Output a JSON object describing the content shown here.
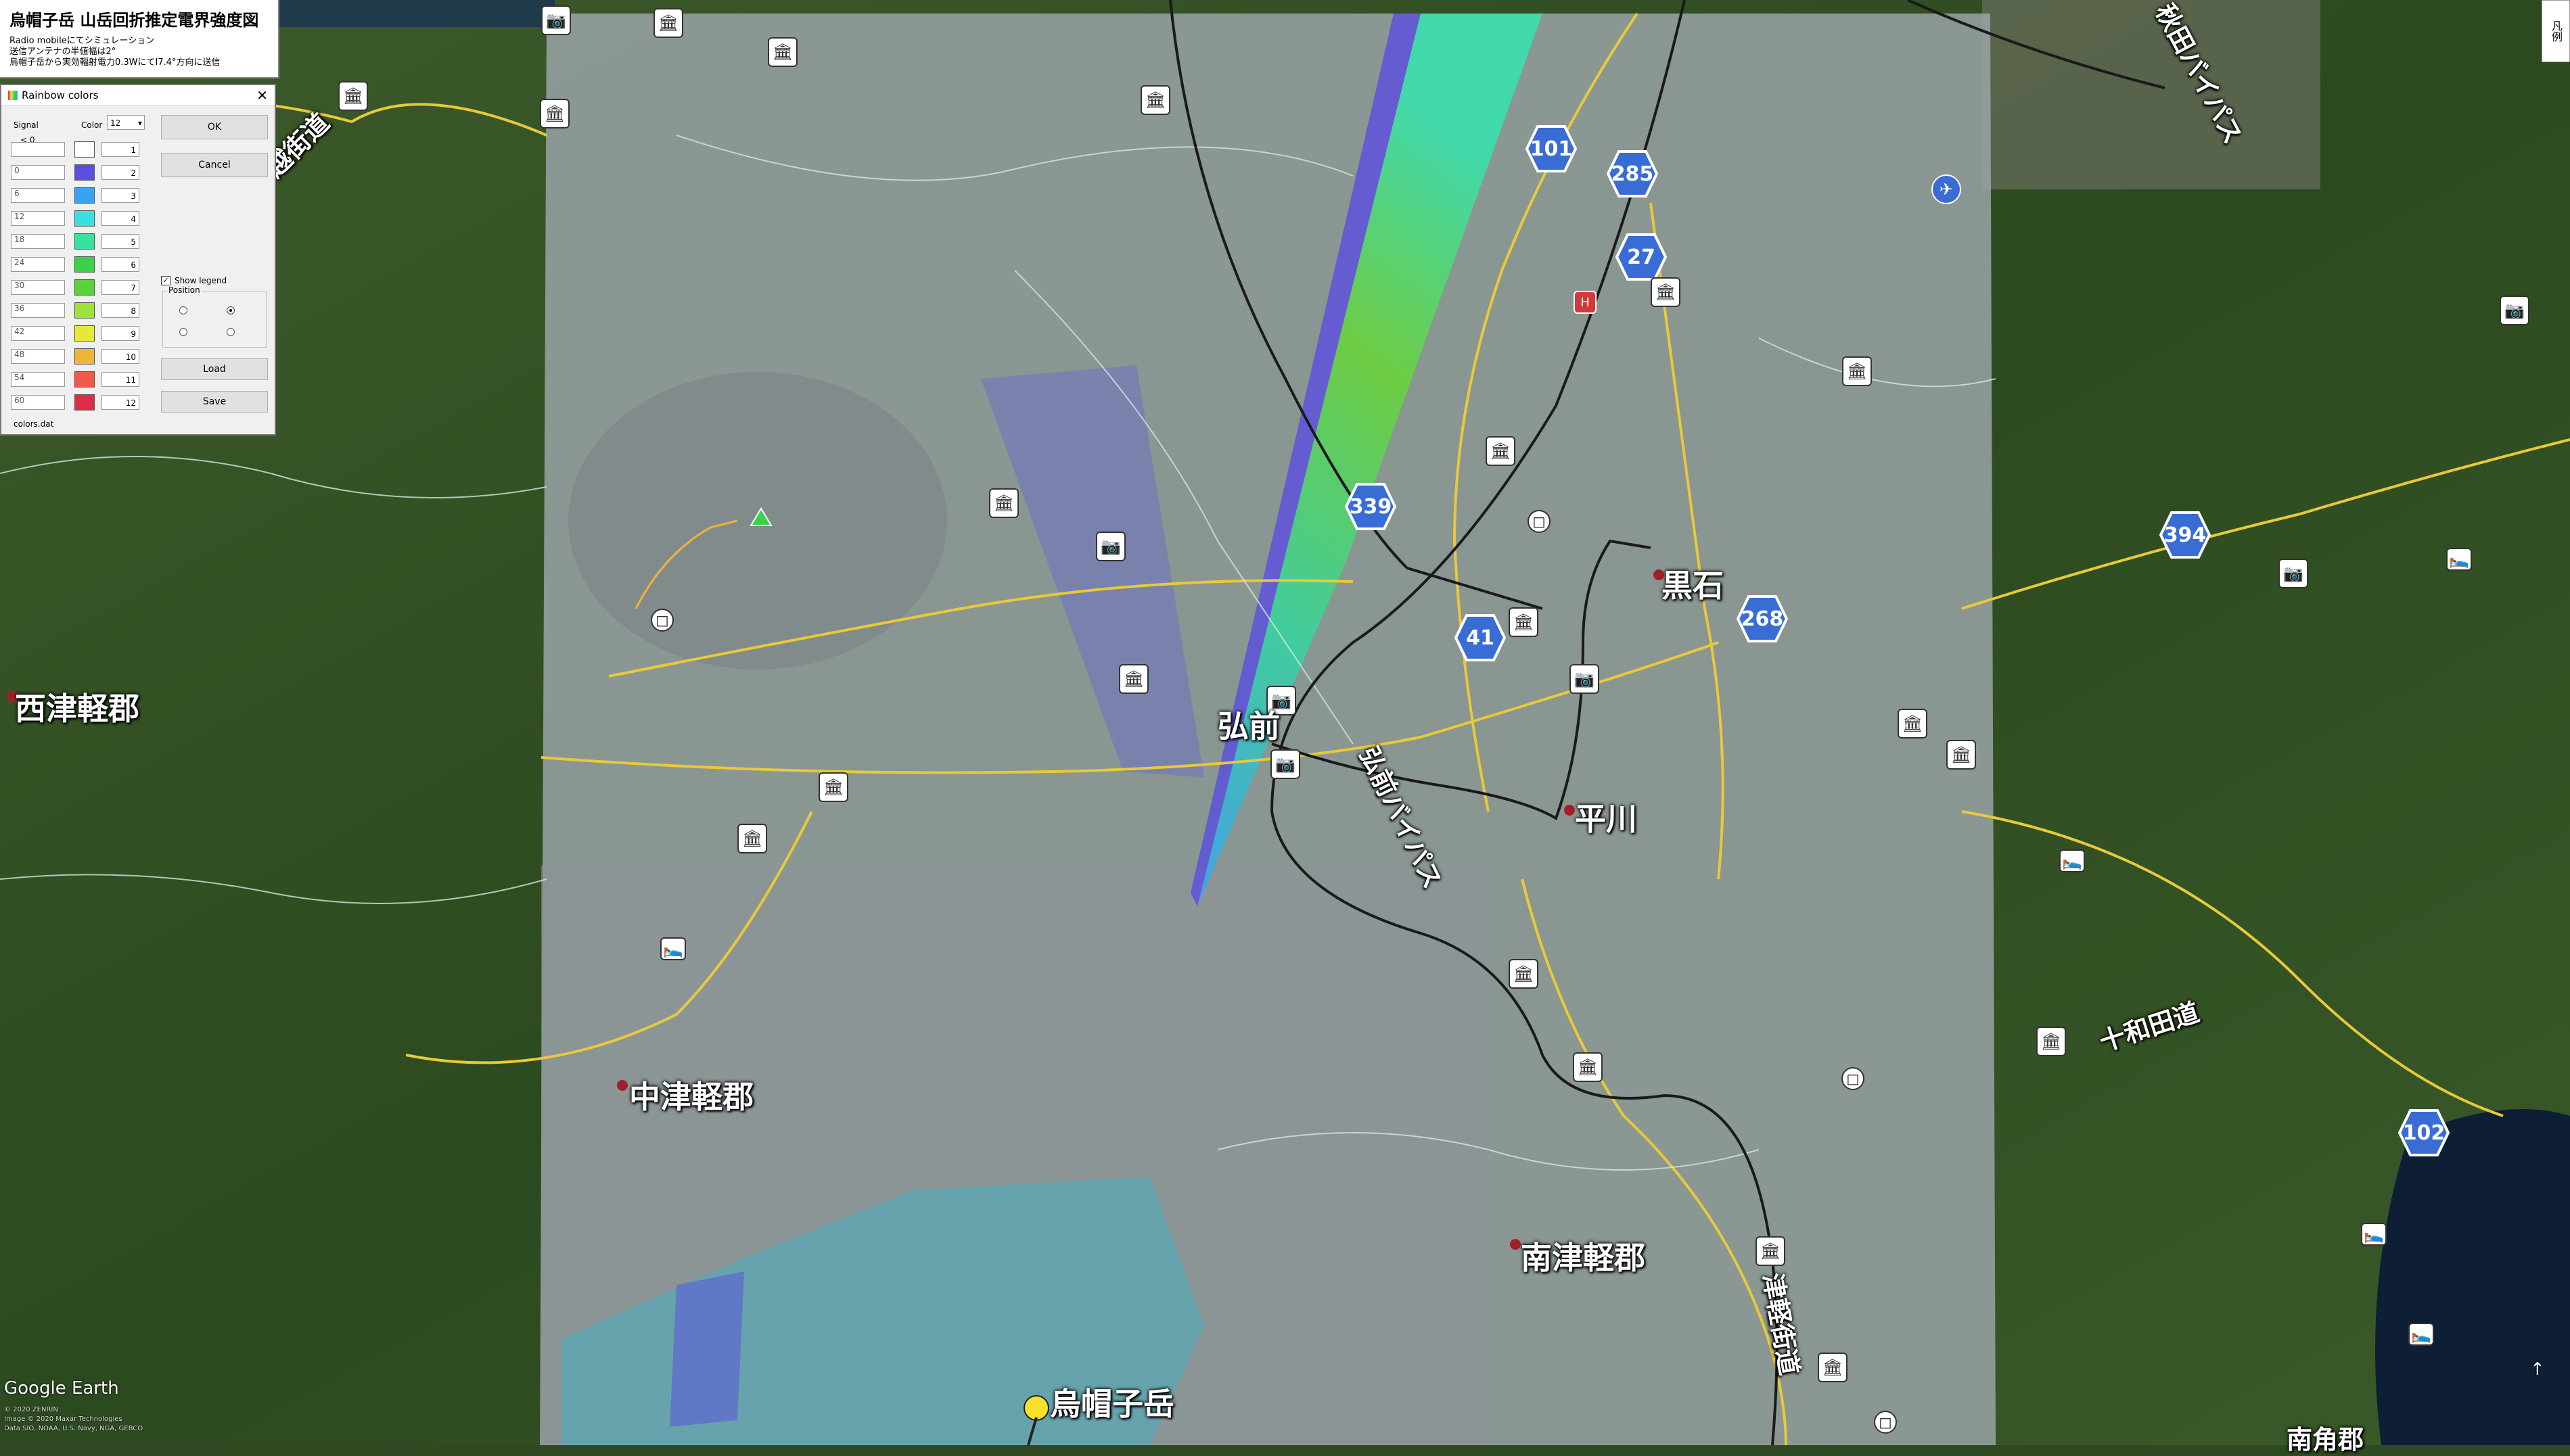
{
  "title_box": {
    "title": "烏帽子岳 山岳回折推定電界強度図",
    "line1": "Radio mobileにてシミュレーション",
    "line2": "送信アンテナの半値幅は2°",
    "line3": "烏帽子岳から実効輻射電力0.3WにてI7.4°方向に送信"
  },
  "dialog": {
    "title": "Rainbow colors",
    "signal_header": "Signal",
    "signal_min": "< 0",
    "color_header": "Color",
    "color_count": "12",
    "show_legend_label": "Show legend",
    "position_label": "Position",
    "buttons": {
      "ok": "OK",
      "cancel": "Cancel",
      "load": "Load",
      "save": "Save"
    },
    "filename": "colors.dat",
    "rows": [
      {
        "signal": "",
        "index": "1",
        "color": "#ffffff"
      },
      {
        "signal": "0",
        "index": "2",
        "color": "#5a4ee0"
      },
      {
        "signal": "6",
        "index": "3",
        "color": "#3aa3f0"
      },
      {
        "signal": "12",
        "index": "4",
        "color": "#3ae0e0"
      },
      {
        "signal": "18",
        "index": "5",
        "color": "#3ae0a0"
      },
      {
        "signal": "24",
        "index": "6",
        "color": "#3ad24a"
      },
      {
        "signal": "30",
        "index": "7",
        "color": "#5ad23a"
      },
      {
        "signal": "36",
        "index": "8",
        "color": "#a0e03a"
      },
      {
        "signal": "42",
        "index": "9",
        "color": "#e8e83a"
      },
      {
        "signal": "48",
        "index": "10",
        "color": "#f0b43a"
      },
      {
        "signal": "54",
        "index": "11",
        "color": "#f05a4a"
      },
      {
        "signal": "60",
        "index": "12",
        "color": "#e02a4a"
      }
    ]
  },
  "legend_tab": "凡例",
  "places": {
    "hirosaki": "弘前",
    "kuroishi": "黒石",
    "hiraka": "平川",
    "nishitsugaru": "西津軽郡",
    "nakatsugaru": "中津軽郡",
    "minamitsugaru": "南津軽郡",
    "eboshidake": "烏帽子岳",
    "hirosaki_bypass": "弘前バイパス",
    "towada_road": "十和田道",
    "kaido": "越街道",
    "hachinohe_road": "津軽街道",
    "minami_bottom": "南角郡",
    "top_right_road": "秋田バイパス"
  },
  "routes": [
    "101",
    "285",
    "27",
    "339",
    "41",
    "268",
    "394",
    "102"
  ],
  "brand": "Google Earth",
  "credits": [
    "© 2020 ZENRIN",
    "Image © 2020 Maxar Technologies",
    "Data SIO, NOAA, U.S. Navy, NGA, GEBCO"
  ],
  "colors": {
    "overlay_gray": "#8e9aa0",
    "road_yellow": "#e9c93a",
    "rail_black": "#1a1a1a",
    "shield_blue": "#3a6cd6"
  }
}
